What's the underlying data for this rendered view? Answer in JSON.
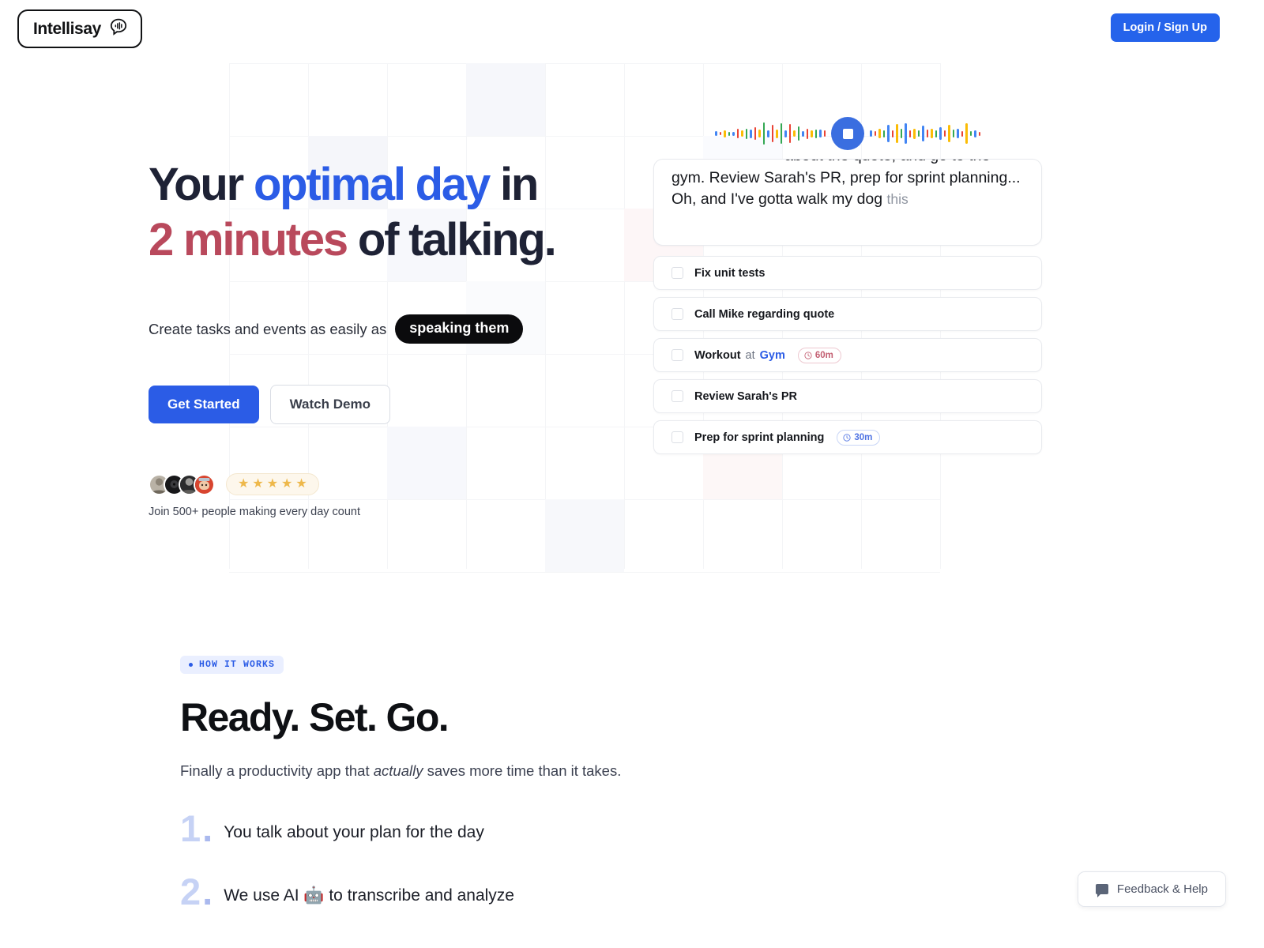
{
  "header": {
    "logo_text": "Intellisay",
    "logo_icon": "speech-bubble-waveform-icon",
    "login_label": "Login / Sign Up"
  },
  "hero": {
    "headline": {
      "line1_part1": "Your ",
      "line1_accent": "optimal day",
      "line1_part2": " in",
      "line2_accent": "2 minutes",
      "line2_part2": " of talking."
    },
    "subline_text": "Create tasks and events as easily as",
    "subline_pill": "speaking them",
    "cta_primary": "Get Started",
    "cta_secondary": "Watch Demo",
    "stars": "★★★★★",
    "star_count": 5,
    "social_caption": "Join 500+ people making every day count",
    "avatar_count": 4
  },
  "app_mock": {
    "record_button_icon": "stop-square-icon",
    "transcript_text": "about the quote, and go to the gym. Review Sarah's PR, prep for sprint planning... Oh, and I've gotta walk my dog",
    "transcript_ghost": "this",
    "tasks": [
      {
        "label": "Fix unit tests",
        "mid": "",
        "location": "",
        "duration": "",
        "duration_style": ""
      },
      {
        "label": "Call Mike regarding quote",
        "mid": "",
        "location": "",
        "duration": "",
        "duration_style": ""
      },
      {
        "label": "Workout",
        "mid": "at",
        "location": "Gym",
        "duration": "60m",
        "duration_style": "red"
      },
      {
        "label": "Review Sarah's PR",
        "mid": "",
        "location": "",
        "duration": "",
        "duration_style": ""
      },
      {
        "label": "Prep for sprint planning",
        "mid": "",
        "location": "",
        "duration": "30m",
        "duration_style": "blue"
      }
    ]
  },
  "how_it_works": {
    "badge": "HOW IT WORKS",
    "title": "Ready. Set. Go.",
    "sub_part1": "Finally a productivity app that ",
    "sub_em": "actually",
    "sub_part2": " saves more time than it takes.",
    "steps": [
      {
        "num": "1",
        "text": "You talk about your plan for the day"
      },
      {
        "num": "2",
        "text": "We use AI 🤖 to transcribe and analyze"
      }
    ]
  },
  "feedback": {
    "label": "Feedback & Help",
    "icon": "chat-bubble-icon"
  },
  "colors": {
    "brand_blue": "#2b5ce6",
    "accent_red": "#b9495c",
    "headline_dark": "#1e2235",
    "step_num": "#c6d2f5",
    "badge_bg": "#eaefff"
  }
}
